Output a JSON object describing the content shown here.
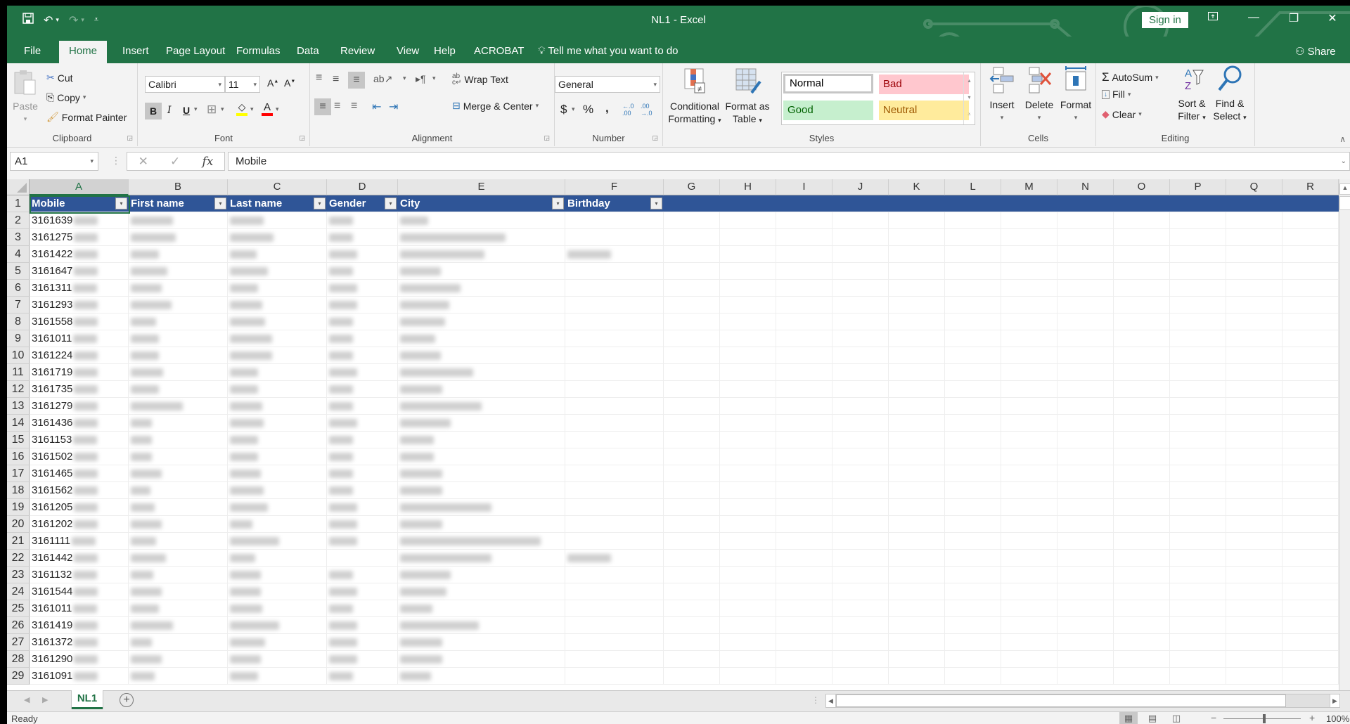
{
  "window": {
    "title": "NL1  -  Excel",
    "sign_in": "Sign in",
    "share": "Share"
  },
  "quick_access": {
    "save": "save-icon",
    "undo": "undo-icon",
    "redo": "redo-icon",
    "customize": "customize-qat-icon"
  },
  "tabs": [
    {
      "label": "File"
    },
    {
      "label": "Home",
      "active": true
    },
    {
      "label": "Insert"
    },
    {
      "label": "Page Layout"
    },
    {
      "label": "Formulas"
    },
    {
      "label": "Data"
    },
    {
      "label": "Review"
    },
    {
      "label": "View"
    },
    {
      "label": "Help"
    },
    {
      "label": "ACROBAT"
    }
  ],
  "tell_me": "Tell me what you want to do",
  "ribbon": {
    "clipboard": {
      "label": "Clipboard",
      "paste": "Paste",
      "cut": "Cut",
      "copy": "Copy",
      "format_painter": "Format Painter"
    },
    "font": {
      "label": "Font",
      "font_name": "Calibri",
      "font_size": "11",
      "bold": "B",
      "italic": "I",
      "underline": "U",
      "fill_color": "#ffff00",
      "font_color": "#ff0000"
    },
    "alignment": {
      "label": "Alignment",
      "wrap_text": "Wrap Text",
      "merge_center": "Merge & Center"
    },
    "number": {
      "label": "Number",
      "format": "General",
      "currency": "$",
      "percent": "%",
      "comma": ",",
      "increase_decimal": "←.0 .00",
      "decrease_decimal": ".00 →.0"
    },
    "styles": {
      "label": "Styles",
      "conditional_formatting": [
        "Conditional",
        "Formatting"
      ],
      "format_as_table": [
        "Format as",
        "Table"
      ],
      "cell_styles": [
        {
          "name": "Normal",
          "bg": "#ffffff",
          "fg": "#000000"
        },
        {
          "name": "Bad",
          "bg": "#ffc7ce",
          "fg": "#9c0006"
        },
        {
          "name": "Good",
          "bg": "#c6efce",
          "fg": "#006100"
        },
        {
          "name": "Neutral",
          "bg": "#ffeb9c",
          "fg": "#9c5700"
        }
      ]
    },
    "cells": {
      "label": "Cells",
      "insert": "Insert",
      "delete": "Delete",
      "format": "Format"
    },
    "editing": {
      "label": "Editing",
      "autosum": "AutoSum",
      "fill": "Fill",
      "clear": "Clear",
      "sort_filter": [
        "Sort &",
        "Filter"
      ],
      "find_select": [
        "Find &",
        "Select"
      ]
    }
  },
  "formula_bar": {
    "name_box": "A1",
    "cancel": "✕",
    "enter": "✓",
    "fx": "fx",
    "content": "Mobile"
  },
  "sheet": {
    "columns": [
      "A",
      "B",
      "C",
      "D",
      "E",
      "F",
      "G",
      "H",
      "I",
      "J",
      "K",
      "L",
      "M",
      "N",
      "O",
      "P",
      "Q",
      "R"
    ],
    "selected_column": "A",
    "headers": [
      "Mobile",
      "First name",
      "Last name",
      "Gender",
      "City",
      "Birthday"
    ],
    "header_bg": "#2f5597",
    "rows": [
      {
        "n": "2",
        "mobile": "3161639"
      },
      {
        "n": "3",
        "mobile": "3161275"
      },
      {
        "n": "4",
        "mobile": "3161422"
      },
      {
        "n": "5",
        "mobile": "3161647"
      },
      {
        "n": "6",
        "mobile": "3161311"
      },
      {
        "n": "7",
        "mobile": "3161293"
      },
      {
        "n": "8",
        "mobile": "3161558"
      },
      {
        "n": "9",
        "mobile": "3161011"
      },
      {
        "n": "10",
        "mobile": "3161224"
      },
      {
        "n": "11",
        "mobile": "3161719"
      },
      {
        "n": "12",
        "mobile": "3161735"
      },
      {
        "n": "13",
        "mobile": "3161279"
      },
      {
        "n": "14",
        "mobile": "3161436"
      },
      {
        "n": "15",
        "mobile": "3161153"
      },
      {
        "n": "16",
        "mobile": "3161502"
      },
      {
        "n": "17",
        "mobile": "3161465"
      },
      {
        "n": "18",
        "mobile": "3161562"
      },
      {
        "n": "19",
        "mobile": "3161205"
      },
      {
        "n": "20",
        "mobile": "3161202"
      },
      {
        "n": "21",
        "mobile": "3161111"
      },
      {
        "n": "22",
        "mobile": "3161442"
      },
      {
        "n": "23",
        "mobile": "3161132"
      },
      {
        "n": "24",
        "mobile": "3161544"
      },
      {
        "n": "25",
        "mobile": "3161011"
      },
      {
        "n": "26",
        "mobile": "3161419"
      },
      {
        "n": "27",
        "mobile": "3161372"
      },
      {
        "n": "28",
        "mobile": "3161290"
      },
      {
        "n": "29",
        "mobile": "3161091"
      }
    ],
    "redacted_note": "cell contents beyond mobile prefix are blurred"
  },
  "sheet_tabs": [
    {
      "label": "NL1",
      "active": true
    }
  ],
  "status": {
    "text": "Ready",
    "zoom": "100%"
  }
}
